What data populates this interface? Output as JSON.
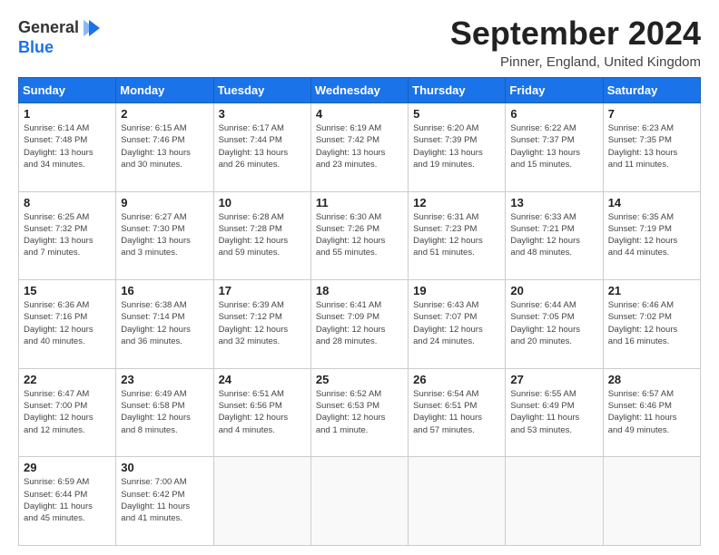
{
  "header": {
    "logo_line1": "General",
    "logo_line2": "Blue",
    "month_title": "September 2024",
    "location": "Pinner, England, United Kingdom"
  },
  "weekdays": [
    "Sunday",
    "Monday",
    "Tuesday",
    "Wednesday",
    "Thursday",
    "Friday",
    "Saturday"
  ],
  "weeks": [
    [
      {
        "day": "1",
        "sunrise": "6:14 AM",
        "sunset": "7:48 PM",
        "daylight": "13 hours and 34 minutes."
      },
      {
        "day": "2",
        "sunrise": "6:15 AM",
        "sunset": "7:46 PM",
        "daylight": "13 hours and 30 minutes."
      },
      {
        "day": "3",
        "sunrise": "6:17 AM",
        "sunset": "7:44 PM",
        "daylight": "13 hours and 26 minutes."
      },
      {
        "day": "4",
        "sunrise": "6:19 AM",
        "sunset": "7:42 PM",
        "daylight": "13 hours and 23 minutes."
      },
      {
        "day": "5",
        "sunrise": "6:20 AM",
        "sunset": "7:39 PM",
        "daylight": "13 hours and 19 minutes."
      },
      {
        "day": "6",
        "sunrise": "6:22 AM",
        "sunset": "7:37 PM",
        "daylight": "13 hours and 15 minutes."
      },
      {
        "day": "7",
        "sunrise": "6:23 AM",
        "sunset": "7:35 PM",
        "daylight": "13 hours and 11 minutes."
      }
    ],
    [
      {
        "day": "8",
        "sunrise": "6:25 AM",
        "sunset": "7:32 PM",
        "daylight": "13 hours and 7 minutes."
      },
      {
        "day": "9",
        "sunrise": "6:27 AM",
        "sunset": "7:30 PM",
        "daylight": "13 hours and 3 minutes."
      },
      {
        "day": "10",
        "sunrise": "6:28 AM",
        "sunset": "7:28 PM",
        "daylight": "12 hours and 59 minutes."
      },
      {
        "day": "11",
        "sunrise": "6:30 AM",
        "sunset": "7:26 PM",
        "daylight": "12 hours and 55 minutes."
      },
      {
        "day": "12",
        "sunrise": "6:31 AM",
        "sunset": "7:23 PM",
        "daylight": "12 hours and 51 minutes."
      },
      {
        "day": "13",
        "sunrise": "6:33 AM",
        "sunset": "7:21 PM",
        "daylight": "12 hours and 48 minutes."
      },
      {
        "day": "14",
        "sunrise": "6:35 AM",
        "sunset": "7:19 PM",
        "daylight": "12 hours and 44 minutes."
      }
    ],
    [
      {
        "day": "15",
        "sunrise": "6:36 AM",
        "sunset": "7:16 PM",
        "daylight": "12 hours and 40 minutes."
      },
      {
        "day": "16",
        "sunrise": "6:38 AM",
        "sunset": "7:14 PM",
        "daylight": "12 hours and 36 minutes."
      },
      {
        "day": "17",
        "sunrise": "6:39 AM",
        "sunset": "7:12 PM",
        "daylight": "12 hours and 32 minutes."
      },
      {
        "day": "18",
        "sunrise": "6:41 AM",
        "sunset": "7:09 PM",
        "daylight": "12 hours and 28 minutes."
      },
      {
        "day": "19",
        "sunrise": "6:43 AM",
        "sunset": "7:07 PM",
        "daylight": "12 hours and 24 minutes."
      },
      {
        "day": "20",
        "sunrise": "6:44 AM",
        "sunset": "7:05 PM",
        "daylight": "12 hours and 20 minutes."
      },
      {
        "day": "21",
        "sunrise": "6:46 AM",
        "sunset": "7:02 PM",
        "daylight": "12 hours and 16 minutes."
      }
    ],
    [
      {
        "day": "22",
        "sunrise": "6:47 AM",
        "sunset": "7:00 PM",
        "daylight": "12 hours and 12 minutes."
      },
      {
        "day": "23",
        "sunrise": "6:49 AM",
        "sunset": "6:58 PM",
        "daylight": "12 hours and 8 minutes."
      },
      {
        "day": "24",
        "sunrise": "6:51 AM",
        "sunset": "6:56 PM",
        "daylight": "12 hours and 4 minutes."
      },
      {
        "day": "25",
        "sunrise": "6:52 AM",
        "sunset": "6:53 PM",
        "daylight": "12 hours and 1 minute."
      },
      {
        "day": "26",
        "sunrise": "6:54 AM",
        "sunset": "6:51 PM",
        "daylight": "11 hours and 57 minutes."
      },
      {
        "day": "27",
        "sunrise": "6:55 AM",
        "sunset": "6:49 PM",
        "daylight": "11 hours and 53 minutes."
      },
      {
        "day": "28",
        "sunrise": "6:57 AM",
        "sunset": "6:46 PM",
        "daylight": "11 hours and 49 minutes."
      }
    ],
    [
      {
        "day": "29",
        "sunrise": "6:59 AM",
        "sunset": "6:44 PM",
        "daylight": "11 hours and 45 minutes."
      },
      {
        "day": "30",
        "sunrise": "7:00 AM",
        "sunset": "6:42 PM",
        "daylight": "11 hours and 41 minutes."
      },
      null,
      null,
      null,
      null,
      null
    ]
  ]
}
